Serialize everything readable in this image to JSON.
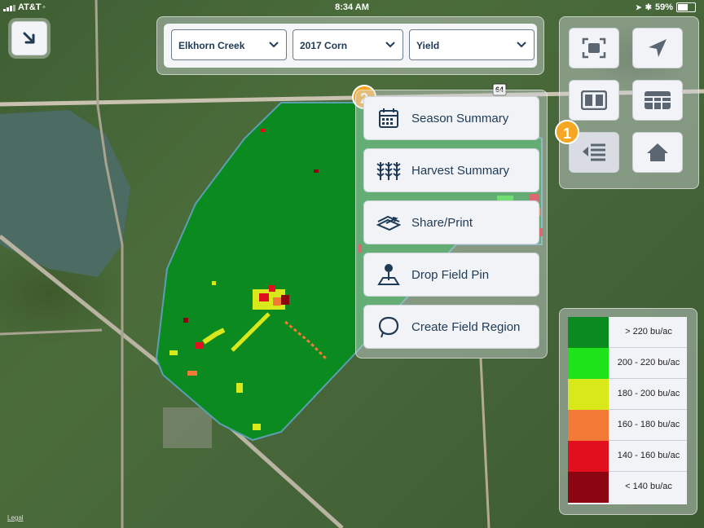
{
  "status_bar": {
    "carrier": "AT&T",
    "time": "8:34 AM",
    "battery": "59%"
  },
  "map": {
    "road_sign": "64",
    "legal_link": "Legal"
  },
  "filters": {
    "farm": "Elkhorn Creek",
    "season": "2017 Corn",
    "layer": "Yield"
  },
  "tools": [
    {
      "name": "fit-to-screen",
      "icon": "fullscreen-icon"
    },
    {
      "name": "locate",
      "icon": "location-arrow-icon"
    },
    {
      "name": "split-view",
      "icon": "split-view-icon"
    },
    {
      "name": "table-view",
      "icon": "table-icon"
    },
    {
      "name": "reports-menu",
      "icon": "list-menu-icon"
    },
    {
      "name": "home",
      "icon": "home-icon"
    }
  ],
  "badges": {
    "badge_1": "1",
    "badge_2": "2"
  },
  "menu": {
    "items": [
      {
        "label": "Season Summary",
        "icon": "calendar-icon"
      },
      {
        "label": "Harvest Summary",
        "icon": "crop-icon"
      },
      {
        "label": "Share/Print",
        "icon": "share-icon"
      },
      {
        "label": "Drop Field Pin",
        "icon": "pin-icon"
      },
      {
        "label": "Create Field Region",
        "icon": "region-icon"
      }
    ]
  },
  "legend": {
    "rows": [
      {
        "range": "> 220 bu/ac",
        "color": "#0a8a1f"
      },
      {
        "range": "200 - 220 bu/ac",
        "color": "#1fe31a"
      },
      {
        "range": "180 - 200 bu/ac",
        "color": "#d9e81a"
      },
      {
        "range": "160 - 180 bu/ac",
        "color": "#f27a36"
      },
      {
        "range": "140 - 160 bu/ac",
        "color": "#e0101e"
      },
      {
        "range": "< 140 bu/ac",
        "color": "#8b0610"
      }
    ]
  },
  "colors": {
    "accent_badge": "#f5a623",
    "text_navy": "#1e3a55",
    "field_green": "#0a8a1f"
  }
}
